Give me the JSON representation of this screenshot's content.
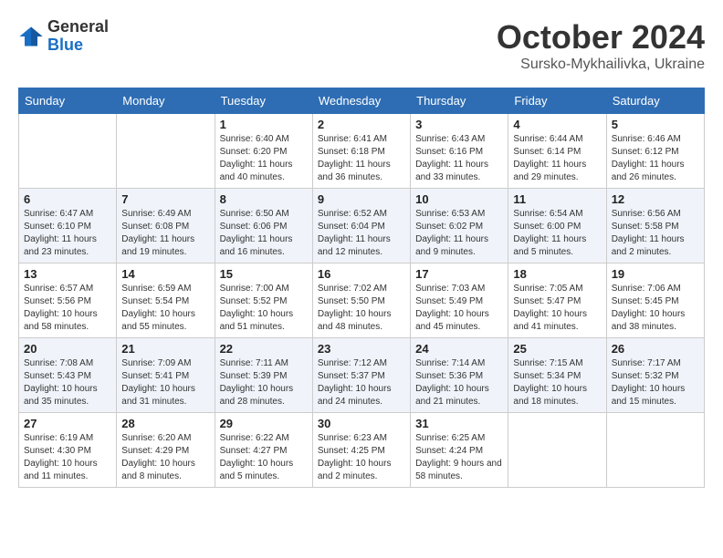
{
  "header": {
    "logo_general": "General",
    "logo_blue": "Blue",
    "title": "October 2024",
    "location": "Sursko-Mykhailivka, Ukraine"
  },
  "days_of_week": [
    "Sunday",
    "Monday",
    "Tuesday",
    "Wednesday",
    "Thursday",
    "Friday",
    "Saturday"
  ],
  "weeks": [
    [
      {
        "day": "",
        "info": ""
      },
      {
        "day": "",
        "info": ""
      },
      {
        "day": "1",
        "info": "Sunrise: 6:40 AM\nSunset: 6:20 PM\nDaylight: 11 hours and 40 minutes."
      },
      {
        "day": "2",
        "info": "Sunrise: 6:41 AM\nSunset: 6:18 PM\nDaylight: 11 hours and 36 minutes."
      },
      {
        "day": "3",
        "info": "Sunrise: 6:43 AM\nSunset: 6:16 PM\nDaylight: 11 hours and 33 minutes."
      },
      {
        "day": "4",
        "info": "Sunrise: 6:44 AM\nSunset: 6:14 PM\nDaylight: 11 hours and 29 minutes."
      },
      {
        "day": "5",
        "info": "Sunrise: 6:46 AM\nSunset: 6:12 PM\nDaylight: 11 hours and 26 minutes."
      }
    ],
    [
      {
        "day": "6",
        "info": "Sunrise: 6:47 AM\nSunset: 6:10 PM\nDaylight: 11 hours and 23 minutes."
      },
      {
        "day": "7",
        "info": "Sunrise: 6:49 AM\nSunset: 6:08 PM\nDaylight: 11 hours and 19 minutes."
      },
      {
        "day": "8",
        "info": "Sunrise: 6:50 AM\nSunset: 6:06 PM\nDaylight: 11 hours and 16 minutes."
      },
      {
        "day": "9",
        "info": "Sunrise: 6:52 AM\nSunset: 6:04 PM\nDaylight: 11 hours and 12 minutes."
      },
      {
        "day": "10",
        "info": "Sunrise: 6:53 AM\nSunset: 6:02 PM\nDaylight: 11 hours and 9 minutes."
      },
      {
        "day": "11",
        "info": "Sunrise: 6:54 AM\nSunset: 6:00 PM\nDaylight: 11 hours and 5 minutes."
      },
      {
        "day": "12",
        "info": "Sunrise: 6:56 AM\nSunset: 5:58 PM\nDaylight: 11 hours and 2 minutes."
      }
    ],
    [
      {
        "day": "13",
        "info": "Sunrise: 6:57 AM\nSunset: 5:56 PM\nDaylight: 10 hours and 58 minutes."
      },
      {
        "day": "14",
        "info": "Sunrise: 6:59 AM\nSunset: 5:54 PM\nDaylight: 10 hours and 55 minutes."
      },
      {
        "day": "15",
        "info": "Sunrise: 7:00 AM\nSunset: 5:52 PM\nDaylight: 10 hours and 51 minutes."
      },
      {
        "day": "16",
        "info": "Sunrise: 7:02 AM\nSunset: 5:50 PM\nDaylight: 10 hours and 48 minutes."
      },
      {
        "day": "17",
        "info": "Sunrise: 7:03 AM\nSunset: 5:49 PM\nDaylight: 10 hours and 45 minutes."
      },
      {
        "day": "18",
        "info": "Sunrise: 7:05 AM\nSunset: 5:47 PM\nDaylight: 10 hours and 41 minutes."
      },
      {
        "day": "19",
        "info": "Sunrise: 7:06 AM\nSunset: 5:45 PM\nDaylight: 10 hours and 38 minutes."
      }
    ],
    [
      {
        "day": "20",
        "info": "Sunrise: 7:08 AM\nSunset: 5:43 PM\nDaylight: 10 hours and 35 minutes."
      },
      {
        "day": "21",
        "info": "Sunrise: 7:09 AM\nSunset: 5:41 PM\nDaylight: 10 hours and 31 minutes."
      },
      {
        "day": "22",
        "info": "Sunrise: 7:11 AM\nSunset: 5:39 PM\nDaylight: 10 hours and 28 minutes."
      },
      {
        "day": "23",
        "info": "Sunrise: 7:12 AM\nSunset: 5:37 PM\nDaylight: 10 hours and 24 minutes."
      },
      {
        "day": "24",
        "info": "Sunrise: 7:14 AM\nSunset: 5:36 PM\nDaylight: 10 hours and 21 minutes."
      },
      {
        "day": "25",
        "info": "Sunrise: 7:15 AM\nSunset: 5:34 PM\nDaylight: 10 hours and 18 minutes."
      },
      {
        "day": "26",
        "info": "Sunrise: 7:17 AM\nSunset: 5:32 PM\nDaylight: 10 hours and 15 minutes."
      }
    ],
    [
      {
        "day": "27",
        "info": "Sunrise: 6:19 AM\nSunset: 4:30 PM\nDaylight: 10 hours and 11 minutes."
      },
      {
        "day": "28",
        "info": "Sunrise: 6:20 AM\nSunset: 4:29 PM\nDaylight: 10 hours and 8 minutes."
      },
      {
        "day": "29",
        "info": "Sunrise: 6:22 AM\nSunset: 4:27 PM\nDaylight: 10 hours and 5 minutes."
      },
      {
        "day": "30",
        "info": "Sunrise: 6:23 AM\nSunset: 4:25 PM\nDaylight: 10 hours and 2 minutes."
      },
      {
        "day": "31",
        "info": "Sunrise: 6:25 AM\nSunset: 4:24 PM\nDaylight: 9 hours and 58 minutes."
      },
      {
        "day": "",
        "info": ""
      },
      {
        "day": "",
        "info": ""
      }
    ]
  ]
}
